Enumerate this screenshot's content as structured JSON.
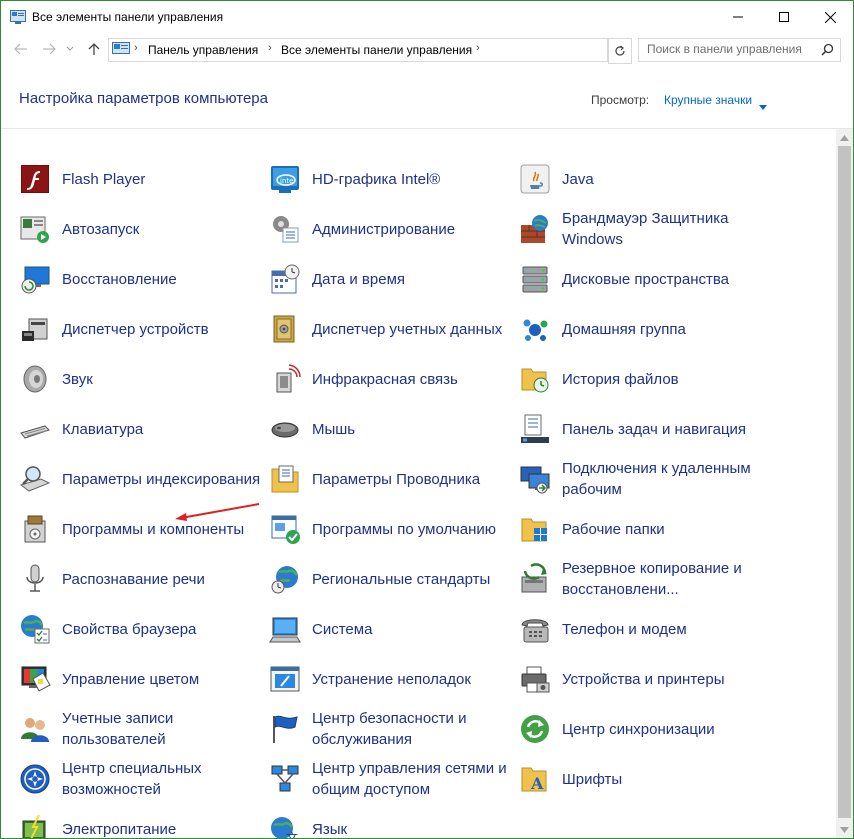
{
  "window": {
    "title": "Все элементы панели управления"
  },
  "address": {
    "crumbs": [
      "Панель управления",
      "Все элементы панели управления"
    ]
  },
  "search": {
    "placeholder": "Поиск в панели управления"
  },
  "header": {
    "title": "Настройка параметров компьютера",
    "view_label": "Просмотр:",
    "view_value": "Крупные значки"
  },
  "items": [
    {
      "label": "Flash Player",
      "icon": "flash-player-icon"
    },
    {
      "label": "HD-графика Intel®",
      "icon": "intel-graphics-icon"
    },
    {
      "label": "Java",
      "icon": "java-icon"
    },
    {
      "label": "Автозапуск",
      "icon": "autoplay-icon"
    },
    {
      "label": "Администрирование",
      "icon": "admin-tools-icon"
    },
    {
      "label": "Брандмауэр Защитника Windows",
      "icon": "firewall-icon"
    },
    {
      "label": "Восстановление",
      "icon": "recovery-icon"
    },
    {
      "label": "Дата и время",
      "icon": "date-time-icon"
    },
    {
      "label": "Дисковые пространства",
      "icon": "storage-spaces-icon"
    },
    {
      "label": "Диспетчер устройств",
      "icon": "device-manager-icon"
    },
    {
      "label": "Диспетчер учетных данных",
      "icon": "credential-manager-icon"
    },
    {
      "label": "Домашняя группа",
      "icon": "homegroup-icon"
    },
    {
      "label": "Звук",
      "icon": "sound-icon"
    },
    {
      "label": "Инфракрасная связь",
      "icon": "infrared-icon"
    },
    {
      "label": "История файлов",
      "icon": "file-history-icon"
    },
    {
      "label": "Клавиатура",
      "icon": "keyboard-icon"
    },
    {
      "label": "Мышь",
      "icon": "mouse-icon"
    },
    {
      "label": "Панель задач и навигация",
      "icon": "taskbar-icon"
    },
    {
      "label": "Параметры индексирования",
      "icon": "indexing-icon"
    },
    {
      "label": "Параметры Проводника",
      "icon": "explorer-options-icon"
    },
    {
      "label": "Подключения к удаленным рабочим",
      "icon": "remote-connections-icon"
    },
    {
      "label": "Программы и компоненты",
      "icon": "programs-features-icon"
    },
    {
      "label": "Программы по умолчанию",
      "icon": "default-programs-icon"
    },
    {
      "label": "Рабочие папки",
      "icon": "work-folders-icon"
    },
    {
      "label": "Распознавание речи",
      "icon": "speech-recognition-icon"
    },
    {
      "label": "Региональные стандарты",
      "icon": "region-icon"
    },
    {
      "label": "Резервное копирование и восстановлени...",
      "icon": "backup-icon"
    },
    {
      "label": "Свойства браузера",
      "icon": "internet-options-icon"
    },
    {
      "label": "Система",
      "icon": "system-icon"
    },
    {
      "label": "Телефон и модем",
      "icon": "phone-modem-icon"
    },
    {
      "label": "Управление цветом",
      "icon": "color-management-icon"
    },
    {
      "label": "Устранение неполадок",
      "icon": "troubleshooting-icon"
    },
    {
      "label": "Устройства и принтеры",
      "icon": "devices-printers-icon"
    },
    {
      "label": "Учетные записи пользователей",
      "icon": "user-accounts-icon"
    },
    {
      "label": "Центр безопасности и обслуживания",
      "icon": "security-maintenance-icon"
    },
    {
      "label": "Центр синхронизации",
      "icon": "sync-center-icon"
    },
    {
      "label": "Центр специальных возможностей",
      "icon": "ease-of-access-icon"
    },
    {
      "label": "Центр управления сетями и общим доступом",
      "icon": "network-center-icon"
    },
    {
      "label": "Шрифты",
      "icon": "fonts-icon"
    },
    {
      "label": "Электропитание",
      "icon": "power-options-icon"
    },
    {
      "label": "Язык",
      "icon": "language-icon"
    }
  ],
  "colors": {
    "link": "#1e3287",
    "accent": "#0066cc",
    "annotation_arrow": "#e02020"
  }
}
